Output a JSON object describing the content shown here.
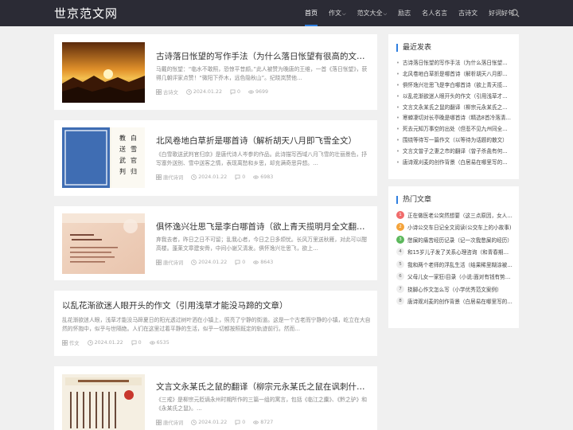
{
  "header": {
    "logo": "世京范文网",
    "nav": [
      {
        "label": "首页",
        "active": true,
        "caret": false
      },
      {
        "label": "作文",
        "active": false,
        "caret": true
      },
      {
        "label": "范文大全",
        "active": false,
        "caret": true
      },
      {
        "label": "励志",
        "active": false,
        "caret": false
      },
      {
        "label": "名人名言",
        "active": false,
        "caret": false
      },
      {
        "label": "古诗文",
        "active": false,
        "caret": false
      },
      {
        "label": "好词好句",
        "active": false,
        "caret": false
      }
    ],
    "search_icon": "search-icon"
  },
  "articles": [
    {
      "title": "古诗落日怅望的写作手法（为什么落日怅望有很高的文坛地位）",
      "excerpt": "马戴的怅望：“临水不敢照，恐惊平昔颜。”此人被赞为晚唐的王维，一首《落日怅望》，获得几朝评家点赞！“微阳下乔木，远色隐秋山”。纪晓岚赞他…",
      "category": "古诗文",
      "date": "2024.01.22",
      "comments": "0",
      "views": "9699"
    },
    {
      "title": "北风卷地白草折是哪首诗（解析胡天八月即飞雪全文）",
      "excerpt": "《白雪歌送武判官归京》是唐代诗人岑参的作品。此诗描写西域八月飞雪的壮丽景色，抒写塞外送别、雪中送客之情，表现离愁和乡思，却充满奇思异想。…",
      "category": "唐代诗词",
      "date": "2024.01.22",
      "comments": "0",
      "views": "6983"
    },
    {
      "title": "俱怀逸兴壮思飞是李白哪首诗（欲上青天揽明月全文翻译）",
      "excerpt": "弃我去者，昨日之日不可留；乱我心者，今日之日多烦忧。长风万里送秋雁，对此可以酣高楼。蓬莱文章建安骨，中间小谢又清发。俱怀逸兴壮思飞，欲上…",
      "category": "唐代诗词",
      "date": "2024.01.22",
      "comments": "0",
      "views": "8643"
    },
    {
      "title": "以乱花渐欲迷人眼开头的作文（引用浅草才能没马蹄的文章）",
      "excerpt": "乱花渐欲迷人眼，浅草才能没马蹄夏日的阳光透过树叶洒在小镇上，照亮了宁静的街道。这是一个古老而宁静的小镇，屹立在大自然的怀抱中，似乎与世隔绝。人们在这里过着平静的生活，似乎一切都按照既定的轨迹前行。然而…",
      "category": "作文",
      "date": "2024.01.22",
      "comments": "0",
      "views": "6535"
    },
    {
      "title": "文言文永某氏之鼠的翻译（柳宗元永某氏之鼠在讽刺什么样的人）",
      "excerpt": "《三戒》是柳宗元贬谪永州时期所作的三篇一组的寓言，包括《临江之麋》、《黔之驴》和《永某氏之鼠》。…",
      "category": "唐代诗词",
      "date": "2024.01.22",
      "comments": "0",
      "views": "8727"
    }
  ],
  "sidebar": {
    "recent_title": "最近发表",
    "recent": [
      "古诗落日怅望的写作手法（为什么落日怅望有很高的文坛地位）",
      "北风卷地白草折是哪首诗（解析胡天八月即飞雪全文）",
      "俱怀逸兴壮思飞是李白哪首诗（欲上青天揽明月全文翻译）",
      "以乱花渐欲迷人眼开头的作文（引用浅草才能没马蹄的文章）",
      "文言文永某氏之鼠的翻译（柳宗元永某氏之鼠在讽刺什么样的人）",
      "寒蝉凄切对长亭晚是哪首诗（精选8首冷落清秋节古诗）",
      "死去元知万事空的出处（但悲不见九州同全诗）",
      "围绕等待写一篇作文（以等待为话题的散文）",
      "文言文曾子之妻之市的翻译（曾子杀彘有何寓意）",
      "唐诗观刈麦的创作背景（白居易在哪里写的观刈麦）"
    ],
    "hot_title": "热门文章",
    "hot": [
      "正在做医老公突然想要（这三点原因，女人一定要知道）",
      "小诗公交车日记全文阅读(公交车上的小故事)",
      "憋屎的痛苦经历记录（记一次我憋屎的经历）",
      "和15岁儿子发了关系心理咨询（和青春期儿子的相处）",
      "我和两个老师的浮乱生活（结果稀里糊涂被开除）",
      "父母儿女一家狂i目录（小说:面对有钱有势的人）",
      "挠脚心作文怎么写（小学优秀范文案例）",
      "唐诗观刈麦的创作背景（白居易在哪里写的观刈麦）"
    ]
  }
}
